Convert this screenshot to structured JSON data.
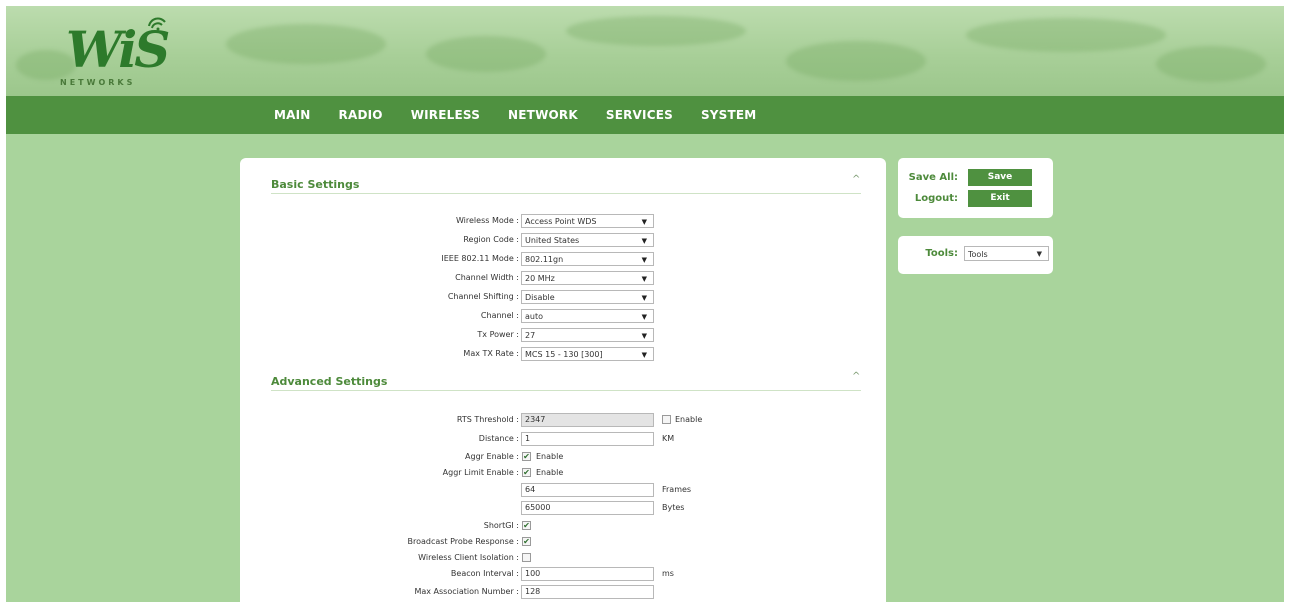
{
  "logo": {
    "text": "WiS",
    "subtext": "NETWORKS"
  },
  "nav": [
    "MAIN",
    "RADIO",
    "WIRELESS",
    "NETWORK",
    "SERVICES",
    "SYSTEM"
  ],
  "basic": {
    "title": "Basic Settings",
    "collapse_icon": "^",
    "fields": [
      {
        "label": "Wireless Mode :",
        "value": "Access Point WDS"
      },
      {
        "label": "Region Code :",
        "value": "United States"
      },
      {
        "label": "IEEE 802.11 Mode :",
        "value": "802.11gn"
      },
      {
        "label": "Channel Width :",
        "value": "20 MHz"
      },
      {
        "label": "Channel Shifting :",
        "value": "Disable"
      },
      {
        "label": "Channel :",
        "value": "auto"
      },
      {
        "label": "Tx Power :",
        "value": "27"
      },
      {
        "label": "Max TX Rate :",
        "value": "MCS 15 - 130 [300]"
      }
    ],
    "caret": "▼"
  },
  "advanced": {
    "title": "Advanced Settings",
    "collapse_icon": "^",
    "rts": {
      "label": "RTS Threshold :",
      "value": "2347",
      "enable_label": "Enable",
      "enabled": false
    },
    "distance": {
      "label": "Distance :",
      "value": "1",
      "unit": "KM"
    },
    "aggr_enable": {
      "label": "Aggr Enable :",
      "checkbox_label": "Enable",
      "checked": true
    },
    "aggr_limit": {
      "label": "Aggr Limit Enable :",
      "checkbox_label": "Enable",
      "checked": true
    },
    "frames": {
      "value": "64",
      "unit": "Frames"
    },
    "bytes": {
      "value": "65000",
      "unit": "Bytes"
    },
    "shortgi": {
      "label": "ShortGI :",
      "checked": true
    },
    "broadcast_probe": {
      "label": "Broadcast Probe Response :",
      "checked": true
    },
    "client_isolation": {
      "label": "Wireless Client Isolation :",
      "checked": false
    },
    "beacon": {
      "label": "Beacon Interval :",
      "value": "100",
      "unit": "ms"
    },
    "max_assoc": {
      "label": "Max Association Number :",
      "value": "128"
    },
    "check_mark": "✔"
  },
  "sidebar": {
    "save_all_label": "Save All:",
    "save_button": "Save",
    "logout_label": "Logout:",
    "exit_button": "Exit",
    "tools_label": "Tools:",
    "tools_value": "Tools",
    "caret": "▼"
  }
}
